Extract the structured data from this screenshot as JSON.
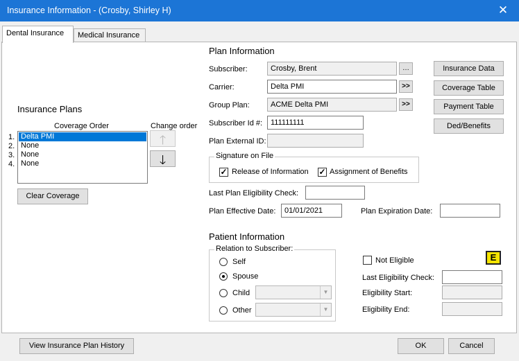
{
  "window": {
    "title": "Insurance Information - (Crosby, Shirley H)",
    "close_glyph": "✕"
  },
  "tabs": [
    {
      "label": "Dental Insurance",
      "active": true
    },
    {
      "label": "Medical Insurance",
      "active": false
    }
  ],
  "insurance_plans": {
    "title": "Insurance Plans",
    "coverage_order_label": "Coverage Order",
    "change_order_label": "Change order",
    "numbers": [
      "1.",
      "2.",
      "3.",
      "4."
    ],
    "items": [
      "Delta PMI",
      "None",
      "None",
      "None"
    ],
    "selected_index": 0,
    "clear_coverage_label": "Clear Coverage",
    "up_glyph": "🡑",
    "down_glyph": "🡓"
  },
  "plan_info": {
    "title": "Plan Information",
    "subscriber_label": "Subscriber:",
    "subscriber_value": "Crosby, Brent",
    "carrier_label": "Carrier:",
    "carrier_value": "Delta PMI",
    "group_plan_label": "Group Plan:",
    "group_plan_value": "ACME Delta PMI",
    "subscriber_id_label": "Subscriber Id #:",
    "subscriber_id_value": "111111111",
    "plan_external_id_label": "Plan External ID:",
    "plan_external_id_value": "",
    "more_glyph": ">>",
    "dots_glyph": "…",
    "signature_group_label": "Signature on File",
    "release_label": "Release of Information",
    "release_checked": true,
    "assignment_label": "Assignment of Benefits",
    "assignment_checked": true,
    "last_plan_elig_label": "Last Plan Eligibility Check:",
    "last_plan_elig_value": "",
    "effective_date_label": "Plan Effective Date:",
    "effective_date_value": "01/01/2021",
    "expiration_date_label": "Plan Expiration Date:",
    "expiration_date_value": ""
  },
  "side_buttons": {
    "insurance_data": "Insurance Data",
    "coverage_table": "Coverage Table",
    "payment_table": "Payment Table",
    "ded_benefits": "Ded/Benefits"
  },
  "patient_info": {
    "title": "Patient Information",
    "relation_group_label": "Relation to Subscriber:",
    "self_label": "Self",
    "spouse_label": "Spouse",
    "child_label": "Child",
    "other_label": "Other",
    "selected_relation": "Spouse",
    "not_eligible_label": "Not Eligible",
    "not_eligible_checked": false,
    "e_button_label": "E",
    "last_elig_label": "Last Eligibility Check:",
    "last_elig_value": "",
    "elig_start_label": "Eligibility Start:",
    "elig_start_value": "",
    "elig_end_label": "Eligibility End:",
    "elig_end_value": ""
  },
  "footer": {
    "history_label": "View Insurance Plan History",
    "ok_label": "OK",
    "cancel_label": "Cancel"
  }
}
